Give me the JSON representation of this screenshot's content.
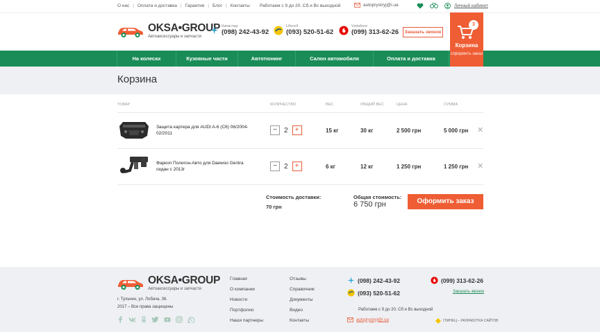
{
  "topbar": {
    "links": [
      "О нас",
      "Оплата и доставка",
      "Гарантия",
      "Блог",
      "Контакты"
    ],
    "hours": "Работаем с 9 до 20. Сб и Вс выходной",
    "email": "autoprystryj@i.ua",
    "cabinet": "Личный кабинет"
  },
  "header": {
    "brand": "OKSA•GROUP",
    "slogan": "Автоаксессуары и запчасти",
    "phones": [
      {
        "operator": "Киевстар",
        "number": "(098) 242-43-92",
        "color": "#2aa5d9"
      },
      {
        "operator": "Lifecell",
        "number": "(093) 520-51-62",
        "color": "#f4c400"
      },
      {
        "operator": "Vodafone",
        "number": "(099) 313-62-26",
        "color": "#e60000"
      }
    ],
    "callback": "Заказать звонок",
    "cart": {
      "count": "3",
      "title": "Корзина",
      "sub": "Оформить заказ"
    }
  },
  "nav": [
    "На колесах",
    "Кузовные части",
    "Автотюнинг",
    "Салон автомобиля",
    "Оплата и доставка"
  ],
  "page": {
    "title": "Корзина"
  },
  "table": {
    "headers": [
      "ТОВАР",
      "КОЛИЧЕСТВО",
      "ВЕС",
      "ОБЩИЙ ВЕС",
      "ЦЕНА",
      "СУММА"
    ],
    "rows": [
      {
        "name": "Защита картера для AUDI A-6 (C6) 06/2004-02/2011",
        "qty": "2",
        "weight": "15 кг",
        "total_weight": "30 кг",
        "price": "2 500 грн",
        "sum": "5 000 грн"
      },
      {
        "name": "Фаркоп Полигон-Авто для Daewoo Gentra седан с 2013г",
        "qty": "2",
        "weight": "6 кг",
        "total_weight": "12 кг",
        "price": "1 250 грн",
        "sum": "1 250 грн"
      }
    ]
  },
  "summary": {
    "delivery_label": "Стоимость доставки:",
    "delivery_value": "70 грн",
    "total_label": "Общая стоимость:",
    "total_value": "6 750 грн",
    "order_button": "Оформить заказ"
  },
  "footer": {
    "brand": "OKSA•GROUP",
    "slogan": "Автоаксессуары и запчасти",
    "address": "г. Тульчин, ул. Лобача, 36.",
    "rights": "2017 – Все права защищены",
    "col1": [
      "Главная",
      "О компании",
      "Новости",
      "Портфолио",
      "Наши партнеры"
    ],
    "col2": [
      "Отзывы",
      "Справочник",
      "Документы",
      "Видео",
      "Контакты"
    ],
    "phone1": "(098) 242-43-92",
    "phone2": "(093) 520-51-62",
    "phone3": "(099) 313-62-26",
    "callback": "Заказать звонок",
    "hours": "Работаем с 9 до 20. Сб и Вс выходной",
    "email": "autoprystryj@i.ua",
    "developer": "ГЛИНЕЦ – РАЗРАБОТКА САЙТОВ"
  }
}
